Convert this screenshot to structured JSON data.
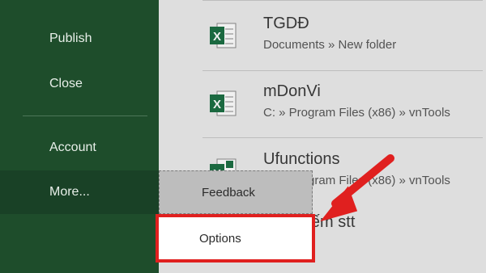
{
  "sidebar": {
    "items": [
      {
        "label": "Publish"
      },
      {
        "label": "Close"
      },
      {
        "label": "Account"
      },
      {
        "label": "More..."
      }
    ]
  },
  "recent": {
    "files": [
      {
        "name": "TGDĐ",
        "path": "Documents » New folder",
        "icon": "excel-file-icon"
      },
      {
        "name": "mDonVi",
        "path": "C: » Program Files (x86) » vnTools",
        "icon": "excel-file-icon"
      },
      {
        "name": "Ufunctions",
        "path": "C: » Program Files (x86) » vnTools",
        "icon": "excel-addin-icon"
      },
      {
        "name": "Total đếm stt",
        "path": "",
        "icon": "excel-file-icon"
      }
    ]
  },
  "popup_menu": {
    "feedback": "Feedback",
    "options": "Options"
  },
  "colors": {
    "sidebar": "#1e4d2b",
    "excel_green": "#1d7044",
    "highlight_red": "#e0201f"
  }
}
